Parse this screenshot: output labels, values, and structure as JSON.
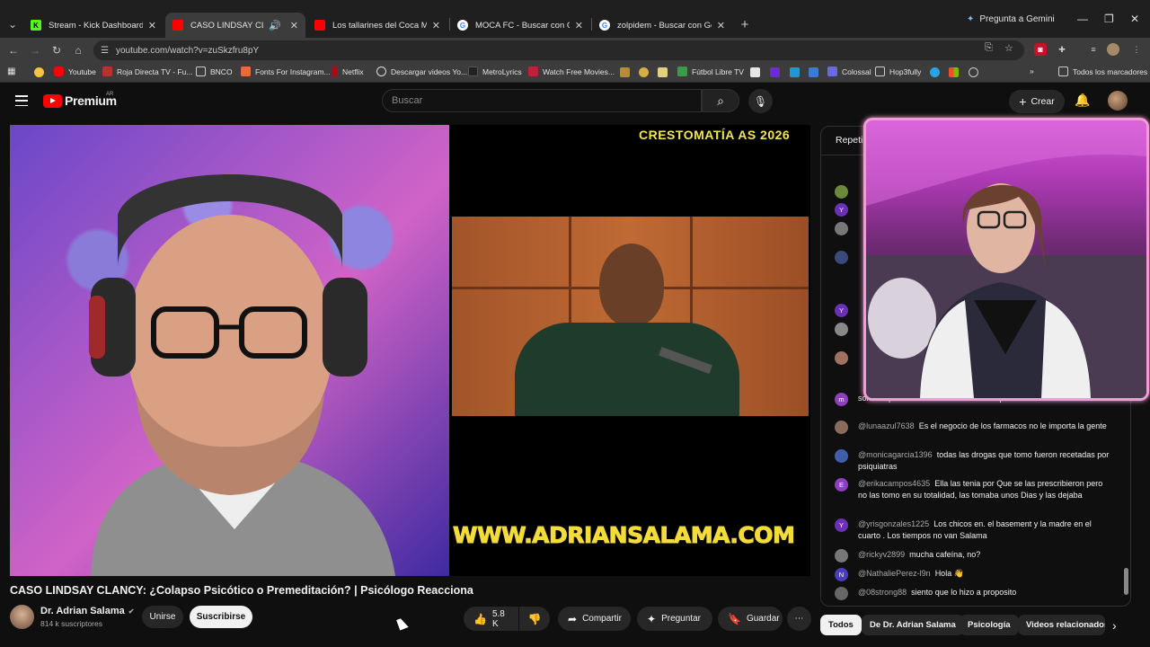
{
  "browser": {
    "tabs": [
      {
        "title": "Stream - Kick Dashboard",
        "favicon_color": "#53fc18",
        "favicon_letter": "K"
      },
      {
        "title": "CASO LINDSAY CLANCY: ¿C",
        "favicon_color": "#ff0000",
        "favicon_letter": ""
      },
      {
        "title": "Los tallarines del Coca Mendoz",
        "favicon_color": "#ff0000",
        "favicon_letter": ""
      },
      {
        "title": "MOCA FC - Buscar con Google",
        "favicon_color": "#ffffff",
        "favicon_letter": "G"
      },
      {
        "title": "zolpidem - Buscar con Google",
        "favicon_color": "#ffffff",
        "favicon_letter": "G"
      }
    ],
    "new_tab_label": "+",
    "gemini_label": "Pregunta a Gemini",
    "url": "youtube.com/watch?v=zuSkzfru8pY",
    "bookmarks": [
      "Youtube",
      "Roja Directa TV - Fu...",
      "BNCO",
      "Fonts For Instagram...",
      "Netflix",
      "Descargar videos Yo...",
      "MetroLyrics",
      "Watch Free Movies...",
      "Fútbol Libre TV",
      "Colossal",
      "Hop3fully"
    ],
    "all_bookmarks_label": "Todos los marcadores"
  },
  "youtube": {
    "logo_text": "Premium",
    "country_code": "AR",
    "search_placeholder": "Buscar",
    "create_label": "Crear"
  },
  "video": {
    "overlay_title": "CRESTOMATÍA AS 2026",
    "overlay_website": "WWW.ADRIANSALAMA.COM",
    "title": "CASO LINDSAY CLANCY: ¿Colapso Psicótico o Premeditación? | Psicólogo Reacciona",
    "channel_name": "Dr. Adrian Salama",
    "subscribers": "814 k suscriptores",
    "join_label": "Unirse",
    "subscribe_label": "Suscribirse",
    "likes": "5.8 K",
    "share_label": "Compartir",
    "ask_label": "Preguntar",
    "save_label": "Guardar"
  },
  "chat": {
    "header": "Repeti",
    "messages": [
      {
        "author": "",
        "text": "son los que tenia el marido en su carro para desasearse de ellos",
        "avatar_letter": "m",
        "avatar_color": "#8e3fbf"
      },
      {
        "author": "@lunaazul7638",
        "text": "Es el negocio de los farmacos no le importa la gente",
        "avatar_letter": "",
        "avatar_color": "#8a6a5a"
      },
      {
        "author": "@monicagarcia1396",
        "text": "todas las drogas que tomo fueron recetadas por psiquiatras",
        "avatar_letter": "",
        "avatar_color": "#3f5fa8"
      },
      {
        "author": "@erikacampos4635",
        "text": "Ella las tenia por Que se las prescribieron pero no las tomo en su totalidad, las tomaba unos Dias y las dejaba",
        "avatar_letter": "E",
        "avatar_color": "#8e3fbf"
      },
      {
        "author": "@yrisgonzales1225",
        "text": "Los chicos en. el basement y la madre en el cuarto . Los tiempos no van Salama",
        "avatar_letter": "Y",
        "avatar_color": "#6b2fb8"
      },
      {
        "author": "@rickyv2899",
        "text": "mucha cafeína, no?",
        "avatar_letter": "",
        "avatar_color": "#777777"
      },
      {
        "author": "@NathaliePerez-l9n",
        "text": "Hola 👋",
        "avatar_letter": "N",
        "avatar_color": "#4a3fb8"
      },
      {
        "author": "@08strong88",
        "text": "siento que lo hizo a proposito",
        "avatar_letter": "",
        "avatar_color": "#666666"
      }
    ]
  },
  "chips": [
    "Todos",
    "De Dr. Adrian Salama",
    "Psicología",
    "Videos relacionados"
  ]
}
